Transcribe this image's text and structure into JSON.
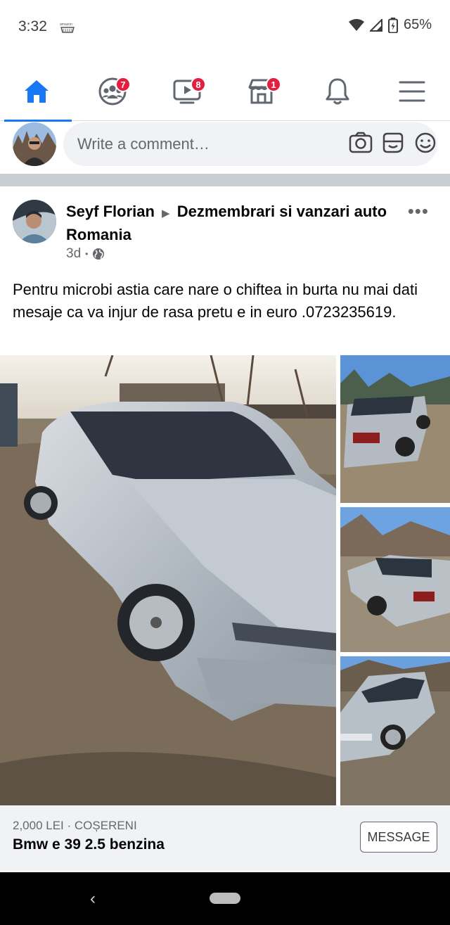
{
  "status_bar": {
    "time": "3:32",
    "battery": "65%",
    "amazon_label": "amazon"
  },
  "nav": {
    "items": [
      {
        "name": "home",
        "badge": ""
      },
      {
        "name": "groups",
        "badge": "7"
      },
      {
        "name": "watch",
        "badge": "8"
      },
      {
        "name": "marketplace",
        "badge": "1"
      },
      {
        "name": "notifications",
        "badge": ""
      },
      {
        "name": "menu",
        "badge": ""
      }
    ],
    "accent": "#1877f2",
    "badge_color": "#e41e3f"
  },
  "comment": {
    "placeholder": "Write a comment…"
  },
  "post": {
    "author": "Seyf Florian",
    "arrow": "▶",
    "group": "Dezmembrari si vanzari auto Romania",
    "time": "3d",
    "separator": "•",
    "body": "Pentru microbi astia care nare o chiftea in  burta nu mai dati mesaje ca va injur de rasa pretu e in euro .0723235619.",
    "more": "•••"
  },
  "listing": {
    "price_location": "2,000 LEI · COȘERENI",
    "title": "Bmw e 39 2.5 benzina",
    "button": "MESSAGE"
  },
  "android_nav": {
    "back": "‹"
  }
}
